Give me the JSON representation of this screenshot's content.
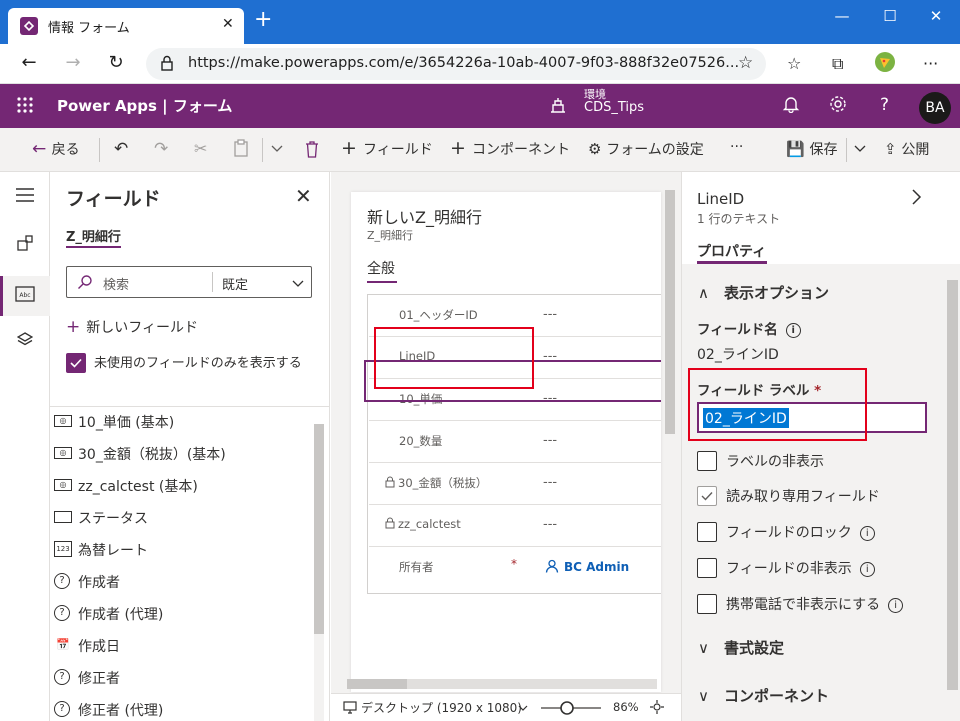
{
  "browser": {
    "tab_title": "情報 フォーム",
    "tab_close": "✕",
    "new_tab": "+",
    "url": "https://make.powerapps.com/e/3654226a-10ab-4007-9f03-888f32e07526...",
    "window_controls": [
      "—",
      "☐",
      "✕"
    ]
  },
  "header": {
    "brand": "Power Apps  |  フォーム",
    "env_label": "環境",
    "env_name": "CDS_Tips",
    "avatar": "BA"
  },
  "commandbar": {
    "back": "戻る",
    "add_field": "フィールド",
    "add_component": "コンポーネント",
    "form_settings": "フォームの設定",
    "more": "···",
    "save": "保存",
    "publish": "公開"
  },
  "fields_panel": {
    "title": "フィールド",
    "close": "✕",
    "entity": "Z_明細行",
    "search_placeholder": "検索",
    "filter": "既定",
    "new_field": "新しいフィールド",
    "unused_only": "未使用のフィールドのみを表示する",
    "items": [
      {
        "icon": "currency-icon",
        "label": "10_単価 (基本)"
      },
      {
        "icon": "currency-icon",
        "label": "30_金額（税抜）(基本)"
      },
      {
        "icon": "currency-icon",
        "label": "zz_calctest (基本)"
      },
      {
        "icon": "option-set-icon",
        "label": "ステータス"
      },
      {
        "icon": "number-icon",
        "label": "為替レート"
      },
      {
        "icon": "lookup-icon",
        "label": "作成者"
      },
      {
        "icon": "lookup-icon",
        "label": "作成者 (代理)"
      },
      {
        "icon": "date-icon",
        "label": "作成日"
      },
      {
        "icon": "lookup-icon",
        "label": "修正者"
      },
      {
        "icon": "lookup-icon",
        "label": "修正者 (代理)"
      }
    ]
  },
  "canvas": {
    "form_title": "新しいZ_明細行",
    "form_entity": "Z_明細行",
    "tab": "全般",
    "rows": [
      {
        "label": "01_ヘッダーID",
        "value": "---",
        "locked": false,
        "required": false
      },
      {
        "label": "LineID",
        "value": "---",
        "locked": false,
        "required": false
      },
      {
        "label": "10_単価",
        "value": "---",
        "locked": false,
        "required": false
      },
      {
        "label": "20_数量",
        "value": "---",
        "locked": false,
        "required": false
      },
      {
        "label": "30_金額（税抜）",
        "value": "---",
        "locked": true,
        "required": false
      },
      {
        "label": "zz_calctest",
        "value": "---",
        "locked": true,
        "required": false
      },
      {
        "label": "所有者",
        "value": "BC Admin",
        "locked": false,
        "required": true
      }
    ],
    "required_mark": "*",
    "device": "デスクトップ (1920 x 1080)",
    "zoom": "86%"
  },
  "props": {
    "title": "LineID",
    "subtitle": "1 行のテキスト",
    "tab": "プロパティ",
    "display_options": "表示オプション",
    "field_name_label": "フィールド名",
    "field_name_value": "02_ラインID",
    "field_label_label": "フィールド ラベル",
    "required_mark": "*",
    "field_label_value": "02_ラインID",
    "checkboxes": [
      {
        "label": "ラベルの非表示",
        "checked": false,
        "info": false
      },
      {
        "label": "読み取り専用フィールド",
        "checked": true,
        "info": false
      },
      {
        "label": "フィールドのロック",
        "checked": false,
        "info": true
      },
      {
        "label": "フィールドの非表示",
        "checked": false,
        "info": true
      },
      {
        "label": "携帯電話で非表示にする",
        "checked": false,
        "info": true
      }
    ],
    "formatting": "書式設定",
    "components": "コンポーネント"
  },
  "colors": {
    "accent": "#742774",
    "highlight_box": "#e3001b",
    "browser_blue": "#1f6fd1",
    "selection_blue": "#0078d4"
  }
}
